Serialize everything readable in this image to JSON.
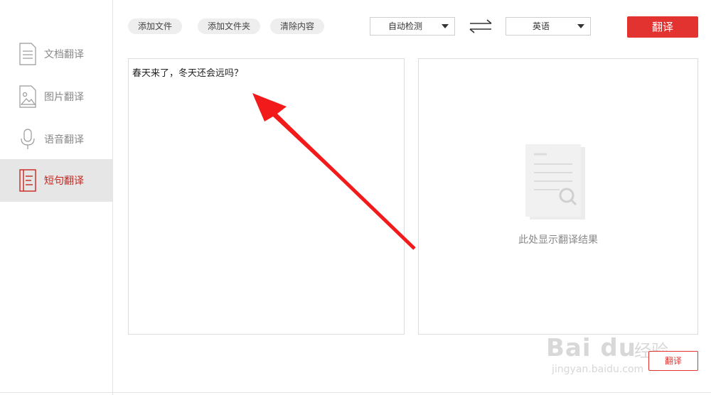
{
  "sidebar": {
    "items": [
      {
        "label": "文档翻译",
        "icon": "document-icon",
        "active": false
      },
      {
        "label": "图片翻译",
        "icon": "image-icon",
        "active": false
      },
      {
        "label": "语音翻译",
        "icon": "microphone-icon",
        "active": false
      },
      {
        "label": "短句翻译",
        "icon": "sentence-icon",
        "active": true
      }
    ]
  },
  "toolbar": {
    "add_file": "添加文件",
    "add_folder": "添加文件夹",
    "clear_content": "清除内容",
    "source_language": "自动检测",
    "target_language": "英语",
    "swap_icon": "swap-icon",
    "translate": "翻译"
  },
  "source_panel": {
    "text": "春天来了，冬天还会远吗？"
  },
  "result_panel": {
    "hint": "此处显示翻译结果",
    "icon": "document-search-icon"
  },
  "bottom_button": "翻译",
  "watermark": {
    "brand": "Bai du",
    "cn": "经验",
    "url": "jingyan.baidu.com"
  },
  "colors": {
    "accent": "#e33330",
    "active_bg": "#e6e6e6",
    "border": "#dcdcdc"
  }
}
